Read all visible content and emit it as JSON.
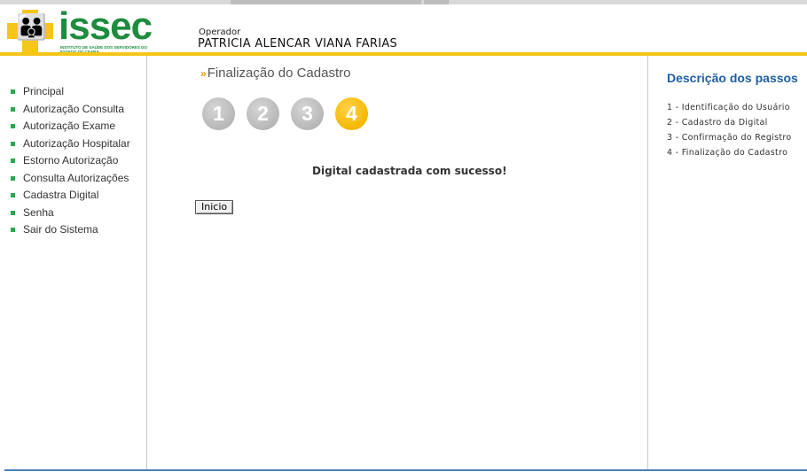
{
  "header": {
    "logo_text": "issec",
    "logo_subtitle": "INSTITUTO DE SAÚDE DOS SERVIDORES DO ESTADO DO CEARÁ",
    "operator_label": "Operador",
    "operator_name": "PATRICIA ALENCAR VIANA FARIAS"
  },
  "sidebar": {
    "items": [
      {
        "label": "Principal"
      },
      {
        "label": "Autorização Consulta"
      },
      {
        "label": "Autorização Exame"
      },
      {
        "label": "Autorização Hospitalar"
      },
      {
        "label": "Estorno Autorização"
      },
      {
        "label": "Consulta Autorizações"
      },
      {
        "label": "Cadastra Digital"
      },
      {
        "label": "Senha"
      },
      {
        "label": "Sair do Sistema"
      }
    ]
  },
  "main": {
    "title_arrows": "»",
    "title": "Finalização do Cadastro",
    "steps": [
      {
        "number": "1",
        "state": "inactive"
      },
      {
        "number": "2",
        "state": "inactive"
      },
      {
        "number": "3",
        "state": "inactive"
      },
      {
        "number": "4",
        "state": "active"
      }
    ],
    "success_message": "Digital cadastrada com sucesso!",
    "button_label": "Inicio"
  },
  "right_panel": {
    "title": "Descrição dos passos",
    "steps": [
      "1 - Identificação do Usuário",
      "2 - Cadastro da Digital",
      "3 - Confirmação do Registro",
      "4 - Finalização do Cadastro"
    ]
  },
  "colors": {
    "brand_green": "#1e8c3e",
    "brand_yellow": "#f5c518",
    "accent_blue": "#1f5fa8",
    "step_active": "#f5b800",
    "step_inactive": "#b5b5b5",
    "bullet": "#2aa84f"
  }
}
